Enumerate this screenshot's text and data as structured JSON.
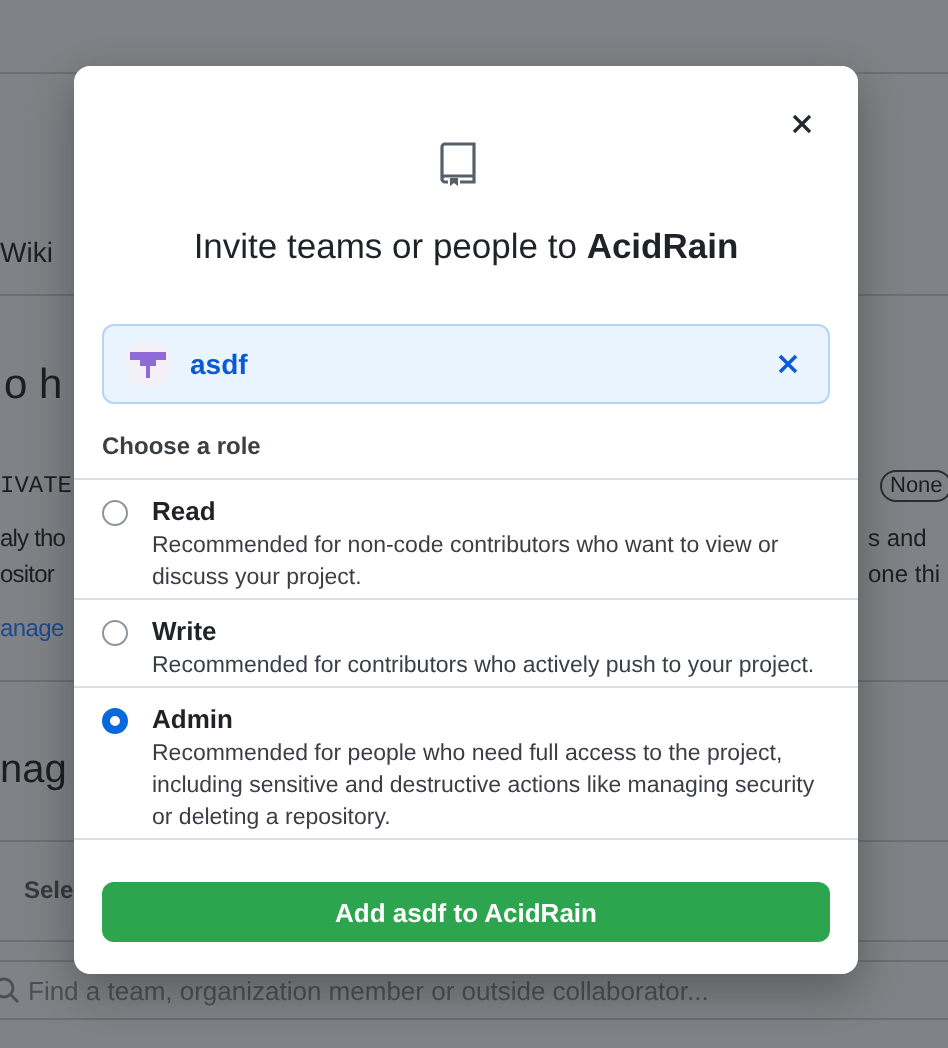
{
  "background": {
    "rows": [
      {
        "kind": "tab",
        "left": "Wiki"
      },
      {
        "kind": "heading",
        "left": "o h"
      },
      {
        "kind": "label",
        "left": "IVATE",
        "right": "None"
      },
      {
        "kind": "text",
        "left": "aly tho",
        "right": "s and"
      },
      {
        "kind": "text",
        "left": "ositor",
        "right": "one thi"
      },
      {
        "kind": "link",
        "left": "anage"
      },
      {
        "kind": "heading",
        "left": "nag"
      },
      {
        "kind": "header",
        "left": "Sele"
      }
    ],
    "search": {
      "placeholder": "Find a team, organization member or outside collaborator..."
    }
  },
  "dialog": {
    "title": "Invite teams or people to **AcidRain**",
    "invitee": {
      "name": "asdf"
    },
    "roles_label": "Choose a role",
    "roles": [
      {
        "name": "Read",
        "description": "Recommended for non-code contributors who want to view or discuss your project.",
        "selected": false
      },
      {
        "name": "Write",
        "description": "Recommended for contributors who actively push to your project.",
        "selected": false
      },
      {
        "name": "Admin",
        "description": "Recommended for people who need full access to the project, including sensitive and destructive actions like managing security or deleting a repository.",
        "selected": true
      }
    ],
    "button": "Add asdf to AcidRain"
  }
}
